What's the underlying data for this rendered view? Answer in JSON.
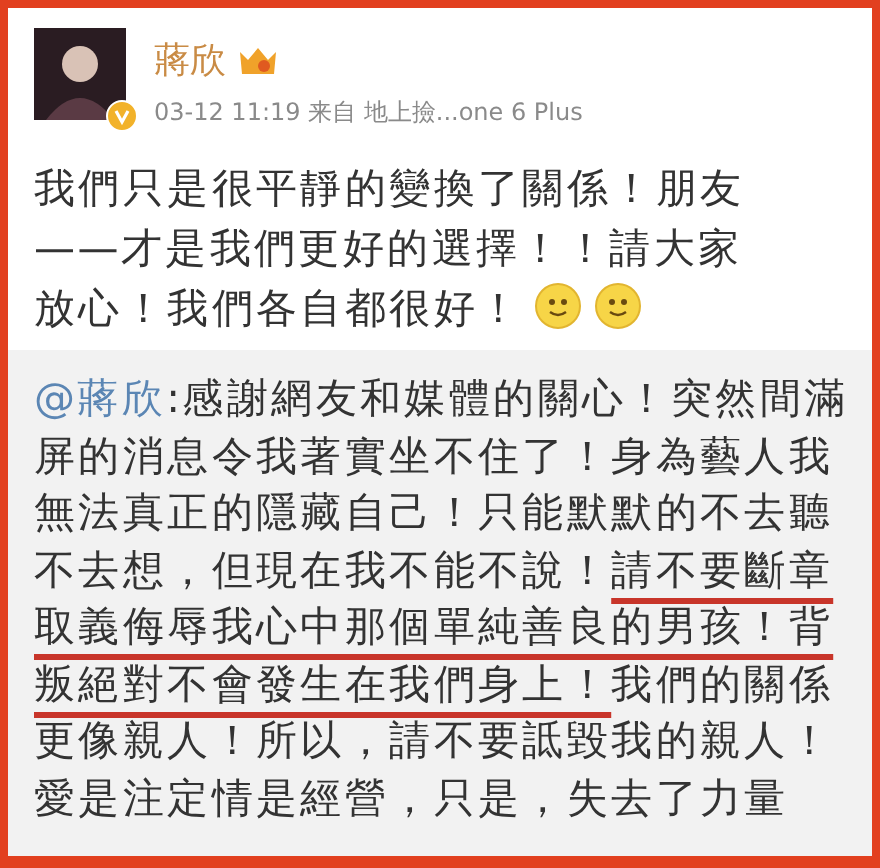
{
  "post": {
    "author": "蔣欣",
    "meta": "03-12 11:19  来自 地上撿...one 6 Plus",
    "text": "我們只是很平靜的變換了關係！朋友——才是我們更好的選擇！！請大家放心！我們各自都很好！",
    "emojis": [
      {
        "kind": "smiley"
      },
      {
        "kind": "smiley"
      }
    ]
  },
  "quoted": {
    "segments": [
      {
        "kind": "mention",
        "text": "@蔣欣"
      },
      {
        "kind": "plain",
        "text": ":感謝網友和媒體的關心！突然間滿屏的消息令我著實坐不住了！身為藝人我無法真正的隱藏自己！只能默默的不去聽不去想，但現在我不能不說！"
      },
      {
        "kind": "underlined",
        "text": "請不要斷章取義侮辱我心中那個單純善良的男孩！背叛絕對不會發生在我們身上！"
      },
      {
        "kind": "plain",
        "text": "我們的關係更像親人！所以，請不要詆毀我的親人！愛是注定情是經營，只是，失去了力量"
      }
    ]
  }
}
